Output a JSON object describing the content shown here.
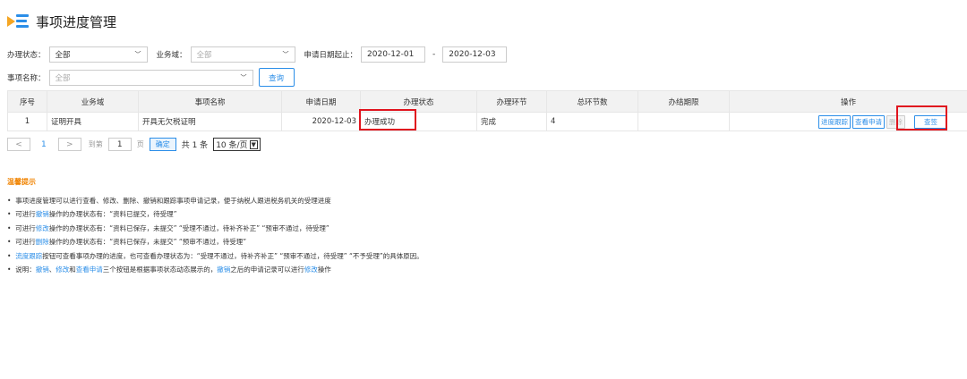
{
  "page": {
    "title": "事项进度管理"
  },
  "filters": {
    "status_label": "办理状态：",
    "status_value": "全部",
    "domain_label": "业务域：",
    "domain_value": "全部",
    "date_label": "申请日期起止：",
    "date_from": "2020-12-01",
    "date_sep": "-",
    "date_to": "2020-12-03",
    "name_label": "事项名称：",
    "name_value": "全部",
    "query_label": "查询"
  },
  "table": {
    "headers": [
      "序号",
      "业务域",
      "事项名称",
      "申请日期",
      "办理状态",
      "办理环节",
      "总环节数",
      "办结期限",
      "操作"
    ],
    "rows": [
      {
        "index": "1",
        "domain": "证明开具",
        "name": "开具无欠税证明",
        "date": "2020-12-03",
        "status": "办理成功",
        "step": "完成",
        "total": "4",
        "deadline": ""
      }
    ],
    "actions": {
      "track": "进度跟踪",
      "view_apply": "查看申请",
      "delete": "删除",
      "view": "查签"
    }
  },
  "pager": {
    "prev": "<",
    "page": "1",
    "next": ">",
    "goto_label": "到第",
    "goto_value": "1",
    "page_unit": "页",
    "confirm": "确定",
    "total": "共 1 条",
    "size": "10 条/页"
  },
  "tips": {
    "title": "温馨提示",
    "lines": [
      {
        "pre": "事项进度管理可以进行查看、修改、删除、撤销和跟踪事项申请记录，便于纳税人跟进税务机关的受理进度"
      },
      {
        "pre": "可进行",
        "link": "撤销",
        "post": "操作的办理状态有：“资料已提交，待受理”"
      },
      {
        "pre": "可进行",
        "link": "修改",
        "post": "操作的办理状态有：“资料已保存，未提交”  “受理不通过，待补齐补正”  “预审不通过，待受理”"
      },
      {
        "pre": "可进行",
        "link": "删除",
        "post": "操作的办理状态有：“资料已保存，未提交”  “预审不通过，待受理”"
      },
      {
        "pre": "",
        "link": "流度跟踪",
        "post": "按钮可查看事项办理的进度，也可查看办理状态为：“受理不通过，待补齐补正”  “预审不通过，待受理”  “不予受理”的具体原因。"
      },
      {
        "pre": "说明：",
        "link": "撤销",
        "mid1": "、",
        "link2": "修改",
        "mid2": "和",
        "link3": "查看申请",
        "mid3": "三个按钮是根据事项状态动态展示的，",
        "link4": "撤销",
        "post": "之后的申请记录可以进行",
        "link5": "修改",
        "post2": "操作"
      }
    ]
  }
}
